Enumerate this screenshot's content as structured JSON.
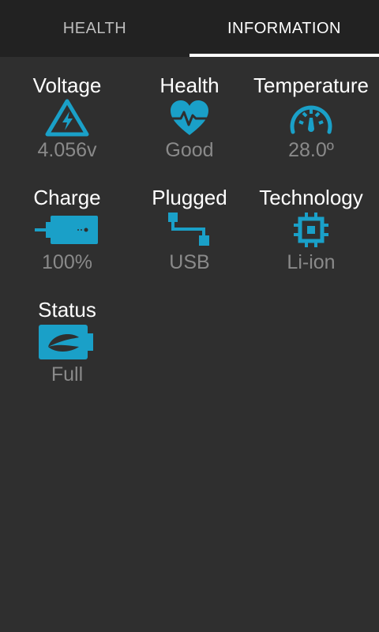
{
  "tabs": [
    {
      "label": "HEALTH",
      "selected": false
    },
    {
      "label": "INFORMATION",
      "selected": true
    }
  ],
  "accent_color": "#1aa0c8",
  "items": [
    {
      "label": "Voltage",
      "value": "4.056v",
      "icon": "voltage-warning-icon"
    },
    {
      "label": "Health",
      "value": "Good",
      "icon": "heart-pulse-icon"
    },
    {
      "label": "Temperature",
      "value": "28.0º",
      "icon": "gauge-icon"
    },
    {
      "label": "Charge",
      "value": "100%",
      "icon": "battery-plug-icon"
    },
    {
      "label": "Plugged",
      "value": "USB",
      "icon": "usb-connector-icon"
    },
    {
      "label": "Technology",
      "value": "Li-ion",
      "icon": "chip-icon"
    },
    {
      "label": "Status",
      "value": "Full",
      "icon": "battery-leaf-icon"
    }
  ]
}
